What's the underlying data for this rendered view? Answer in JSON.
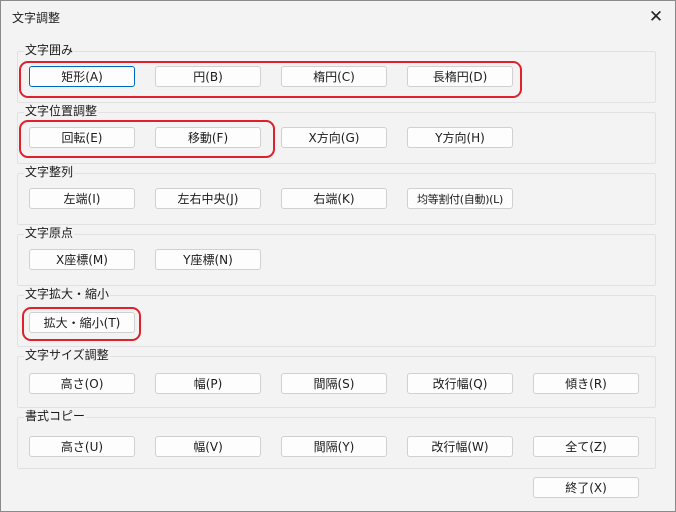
{
  "window": {
    "title": "文字調整",
    "close_glyph": "✕"
  },
  "highlight_color": "#e0202a",
  "groups": [
    {
      "title": "文字囲み",
      "buttons": [
        "矩形(A)",
        "円(B)",
        "楕円(C)",
        "長楕円(D)"
      ]
    },
    {
      "title": "文字位置調整",
      "buttons": [
        "回転(E)",
        "移動(F)",
        "X方向(G)",
        "Y方向(H)"
      ]
    },
    {
      "title": "文字整列",
      "buttons": [
        "左端(I)",
        "左右中央(J)",
        "右端(K)",
        "均等割付(自動)(L)"
      ]
    },
    {
      "title": "文字原点",
      "buttons": [
        "X座標(M)",
        "Y座標(N)"
      ]
    },
    {
      "title": "文字拡大・縮小",
      "buttons": [
        "拡大・縮小(T)"
      ]
    },
    {
      "title": "文字サイズ調整",
      "buttons": [
        "高さ(O)",
        "幅(P)",
        "間隔(S)",
        "改行幅(Q)",
        "傾き(R)"
      ]
    },
    {
      "title": "書式コピー",
      "buttons": [
        "高さ(U)",
        "幅(V)",
        "間隔(Y)",
        "改行幅(W)",
        "全て(Z)"
      ]
    }
  ],
  "footer": {
    "close_label": "終了(X)"
  }
}
